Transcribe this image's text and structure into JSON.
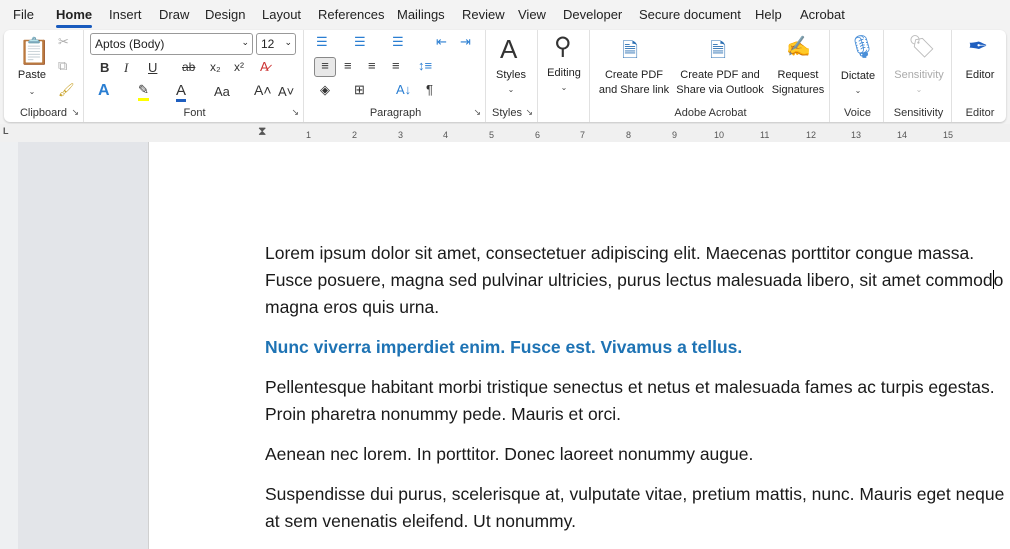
{
  "menu": [
    "File",
    "Home",
    "Insert",
    "Draw",
    "Design",
    "Layout",
    "References",
    "Mailings",
    "Review",
    "View",
    "Developer",
    "Secure document",
    "Help",
    "Acrobat"
  ],
  "clipboard": {
    "paste": "Paste",
    "label": "Clipboard"
  },
  "font": {
    "name": "Aptos (Body)",
    "size": "12",
    "label": "Font",
    "bold": "B",
    "italic": "I",
    "underline": "U",
    "strike": "ab",
    "subscript": "x₂",
    "superscript": "x²",
    "case": "Aa",
    "grow": "A˄",
    "shrink": "A˅"
  },
  "paragraph": {
    "label": "Paragraph",
    "pilcrow": "¶"
  },
  "styles": {
    "button": "Styles",
    "label": "Styles"
  },
  "editing": {
    "button": "Editing"
  },
  "acrobat": {
    "label": "Adobe Acrobat",
    "b1": [
      "Create PDF",
      "and Share link"
    ],
    "b2": [
      "Create PDF and",
      "Share via Outlook"
    ],
    "b3": [
      "Request",
      "Signatures"
    ]
  },
  "voice": {
    "button": "Dictate",
    "label": "Voice"
  },
  "sensitivity": {
    "button": "Sensitivity",
    "label": "Sensitivity"
  },
  "editor": {
    "button": "Editor",
    "label": "Editor"
  },
  "ruler": [
    "1",
    "2",
    "3",
    "4",
    "5",
    "6",
    "7",
    "8",
    "9",
    "10",
    "11",
    "12",
    "13",
    "14",
    "15"
  ],
  "doc": {
    "p1a": "Lorem ipsum dolor sit amet, consectetuer adipiscing elit. Maecenas porttitor congue massa. Fusce posuere, magna sed pulvinar ultricies, purus lectus malesuada libero, sit amet commod",
    "p1b": "o magna eros quis urna.",
    "heading": "Nunc viverra imperdiet enim. Fusce est. Vivamus a tellus.",
    "p2": "Pellentesque habitant morbi tristique senectus et netus et malesuada fames ac turpis egestas. Proin pharetra nonummy pede. Mauris et orci.",
    "p3": "Aenean nec lorem. In porttitor. Donec laoreet nonummy augue.",
    "p4": "Suspendisse dui purus, scelerisque at, vulputate vitae, pretium mattis, nunc. Mauris eget neque at sem venenatis eleifend. Ut nonummy."
  },
  "colors": {
    "accent": "#185abd",
    "heading": "#1e73b4"
  }
}
